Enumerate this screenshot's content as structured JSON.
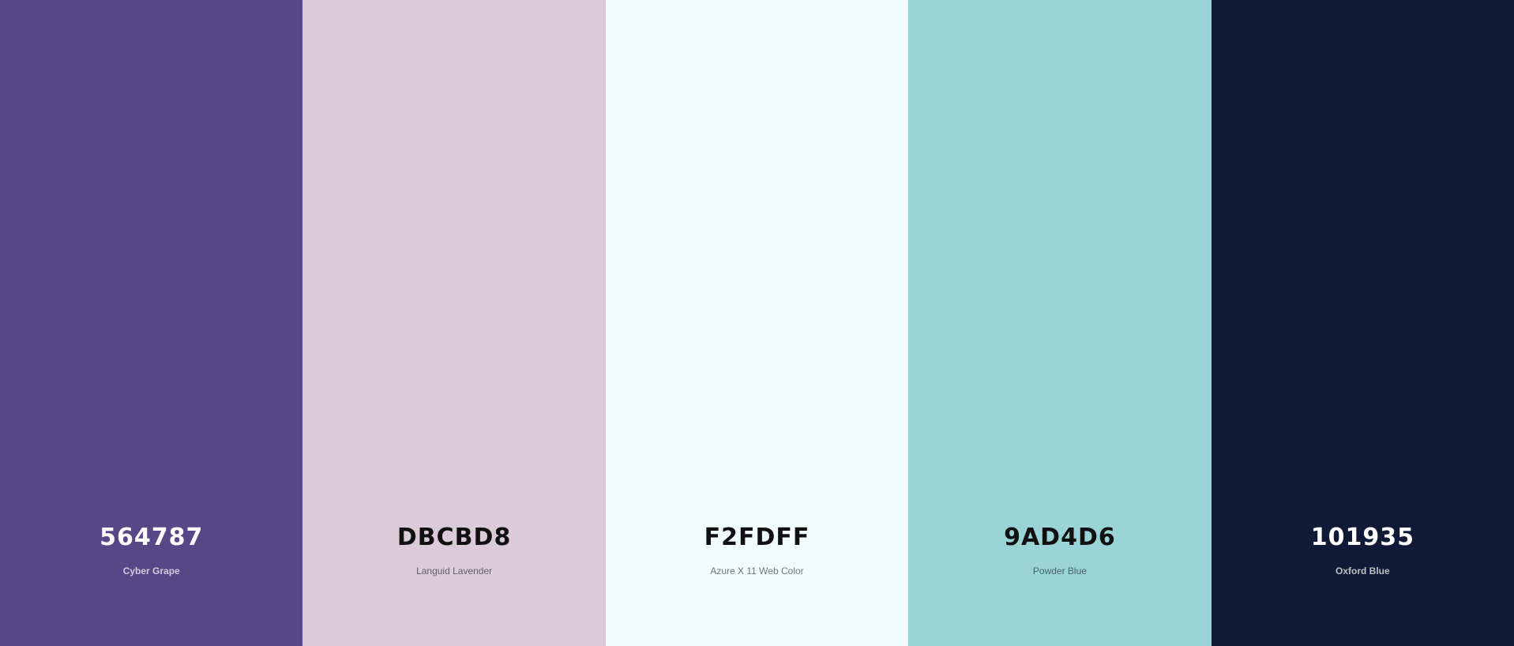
{
  "palette": {
    "swatches": [
      {
        "hex": "564787",
        "name": "Cyber Grape",
        "color": "#564787",
        "tone": "dark"
      },
      {
        "hex": "DBCBD8",
        "name": "Languid Lavender",
        "color": "#DBCBD8",
        "tone": "light"
      },
      {
        "hex": "F2FDFF",
        "name": "Azure X 11 Web Color",
        "color": "#F2FDFF",
        "tone": "light"
      },
      {
        "hex": "9AD4D6",
        "name": "Powder Blue",
        "color": "#9AD4D6",
        "tone": "light"
      },
      {
        "hex": "101935",
        "name": "Oxford Blue",
        "color": "#101935",
        "tone": "dark"
      }
    ]
  }
}
